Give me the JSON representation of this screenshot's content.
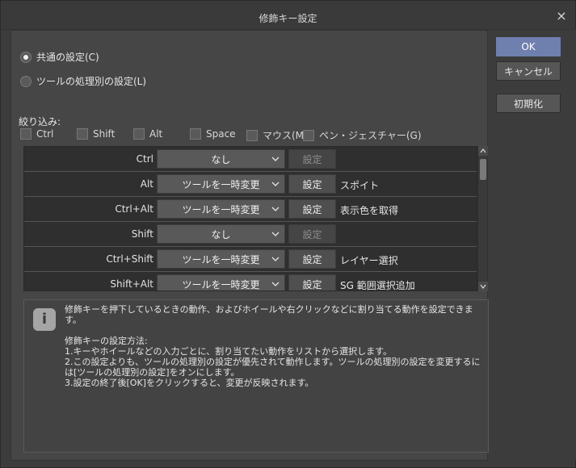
{
  "window": {
    "title": "修飾キー設定",
    "close_label": "×"
  },
  "buttons": {
    "ok": "OK",
    "cancel": "キャンセル",
    "reset": "初期化"
  },
  "mode": {
    "common_label": "共通の設定(C)",
    "per_tool_label": "ツールの処理別の設定(L)",
    "selected": "common"
  },
  "filter": {
    "label": "絞り込み:",
    "checks": [
      {
        "label": "Ctrl",
        "checked": false
      },
      {
        "label": "Shift",
        "checked": false
      },
      {
        "label": "Alt",
        "checked": false
      },
      {
        "label": "Space",
        "checked": false
      },
      {
        "label": "マウス(M)",
        "checked": false
      },
      {
        "label": "ペン・ジェスチャー(G)",
        "checked": false
      }
    ]
  },
  "rows": [
    {
      "key": "Ctrl",
      "action": "なし",
      "set_label": "設定",
      "set_enabled": false,
      "value": ""
    },
    {
      "key": "Alt",
      "action": "ツールを一時変更",
      "set_label": "設定",
      "set_enabled": true,
      "value": "スポイト"
    },
    {
      "key": "Ctrl+Alt",
      "action": "ツールを一時変更",
      "set_label": "設定",
      "set_enabled": true,
      "value": "表示色を取得"
    },
    {
      "key": "Shift",
      "action": "なし",
      "set_label": "設定",
      "set_enabled": false,
      "value": ""
    },
    {
      "key": "Ctrl+Shift",
      "action": "ツールを一時変更",
      "set_label": "設定",
      "set_enabled": true,
      "value": "レイヤー選択"
    },
    {
      "key": "Shift+Alt",
      "action": "ツールを一時変更",
      "set_label": "設定",
      "set_enabled": true,
      "value": "SG 範囲選択追加"
    }
  ],
  "info": {
    "icon_label": "i",
    "text": "修飾キーを押下しているときの動作、およびホイールや右クリックなどに割り当てる動作を設定できます。\n\n修飾キーの設定方法:\n1.キーやホイールなどの入力ごとに、割り当てたい動作をリストから選択します。\n2.この設定よりも、ツールの処理別の設定が優先されて動作します。ツールの処理別の設定を変更するには[ツールの処理別の設定]をオンにします。\n3.設定の終了後[OK]をクリックすると、変更が反映されます。"
  },
  "icons": {
    "close": "close-icon",
    "dropdown": "chevron-down-icon",
    "scroll_up": "scroll-up-icon",
    "scroll_down": "scroll-down-icon",
    "info": "info-icon"
  }
}
